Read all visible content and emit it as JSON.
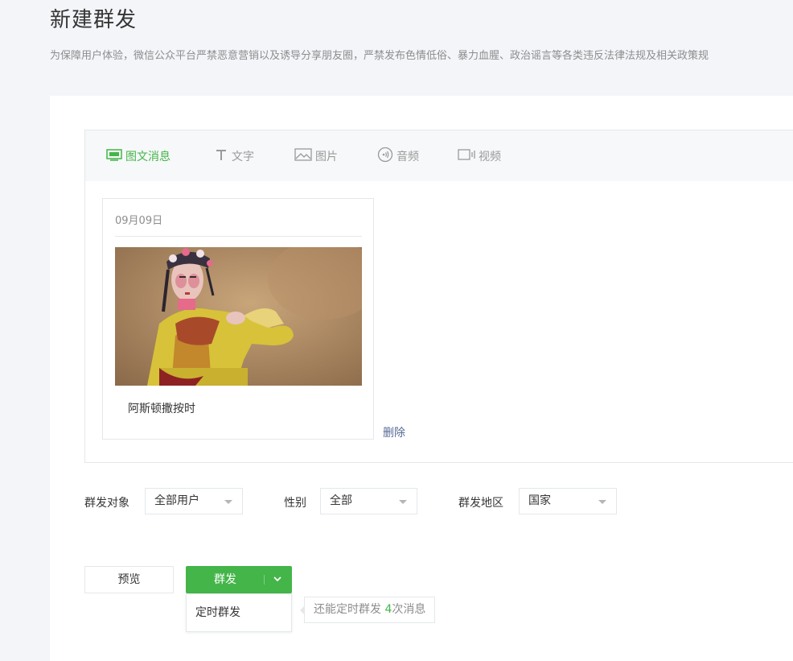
{
  "page": {
    "title": "新建群发",
    "notice": "为保障用户体验，微信公众平台严禁恶意营销以及诱导分享朋友圈，严禁发布色情低俗、暴力血腥、政治谣言等各类违反法律法规及相关政策规"
  },
  "tabs": [
    {
      "label": "图文消息",
      "icon": "news-icon",
      "active": true
    },
    {
      "label": "文字",
      "icon": "text-icon",
      "active": false
    },
    {
      "label": "图片",
      "icon": "image-icon",
      "active": false
    },
    {
      "label": "音频",
      "icon": "audio-icon",
      "active": false
    },
    {
      "label": "视频",
      "icon": "video-icon",
      "active": false
    }
  ],
  "card": {
    "date": "09月09日",
    "title": "阿斯顿撒按时"
  },
  "delete_label": "删除",
  "filters": {
    "target": {
      "label": "群发对象",
      "value": "全部用户"
    },
    "gender": {
      "label": "性别",
      "value": "全部"
    },
    "region": {
      "label": "群发地区",
      "value": "国家"
    }
  },
  "actions": {
    "preview": "预览",
    "send": "群发",
    "scheduled_send": "定时群发"
  },
  "tip": {
    "prefix": "还能定时群发 ",
    "count": "4",
    "suffix": "次消息"
  },
  "colors": {
    "accent": "#44b549",
    "link": "#576b95",
    "background": "#f4f5f9"
  }
}
